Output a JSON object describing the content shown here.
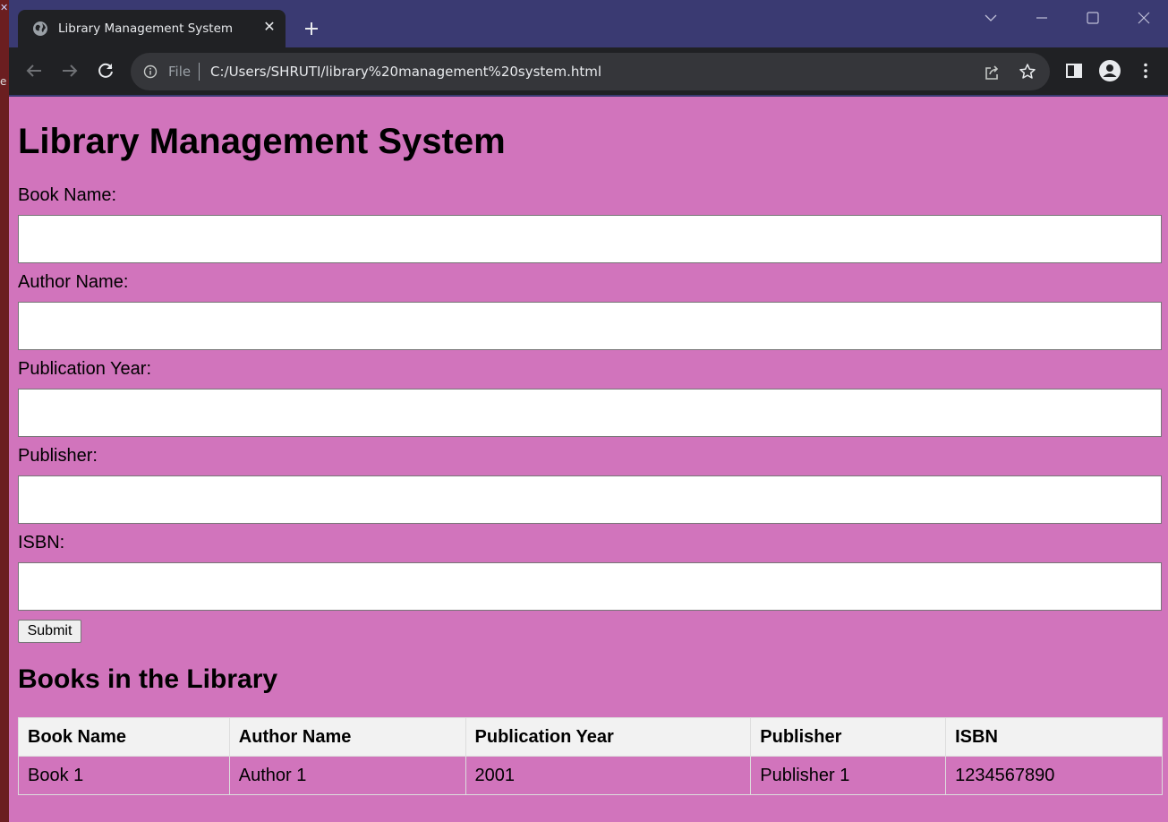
{
  "browser": {
    "tab_title": "Library Management System",
    "close_tab_symbol": "✕",
    "scheme_label": "File",
    "url": "C:/Users/SHRUTI/library%20management%20system.html",
    "icons": [
      "globe-icon",
      "close-icon",
      "plus-icon",
      "chevron-down-icon",
      "minimize-icon",
      "maximize-icon",
      "close-window-icon",
      "back-arrow-icon",
      "forward-arrow-icon",
      "reload-icon",
      "info-icon",
      "share-icon",
      "star-icon",
      "side-panel-icon",
      "profile-icon",
      "more-vertical-icon"
    ],
    "colors": {
      "tabstrip": "#3a3a72",
      "toolbar": "#202124",
      "page_background": "#d174bc"
    }
  },
  "page": {
    "title": "Library Management System",
    "form": {
      "book_name_label": "Book Name:",
      "book_name_value": "",
      "author_name_label": "Author Name:",
      "author_name_value": "",
      "publication_year_label": "Publication Year:",
      "publication_year_value": "",
      "publisher_label": "Publisher:",
      "publisher_value": "",
      "isbn_label": "ISBN:",
      "isbn_value": "",
      "submit_label": "Submit"
    },
    "list_title": "Books in the Library",
    "table": {
      "headers": [
        "Book Name",
        "Author Name",
        "Publication Year",
        "Publisher",
        "ISBN"
      ],
      "rows": [
        [
          "Book 1",
          "Author 1",
          "2001",
          "Publisher 1",
          "1234567890"
        ]
      ]
    }
  }
}
